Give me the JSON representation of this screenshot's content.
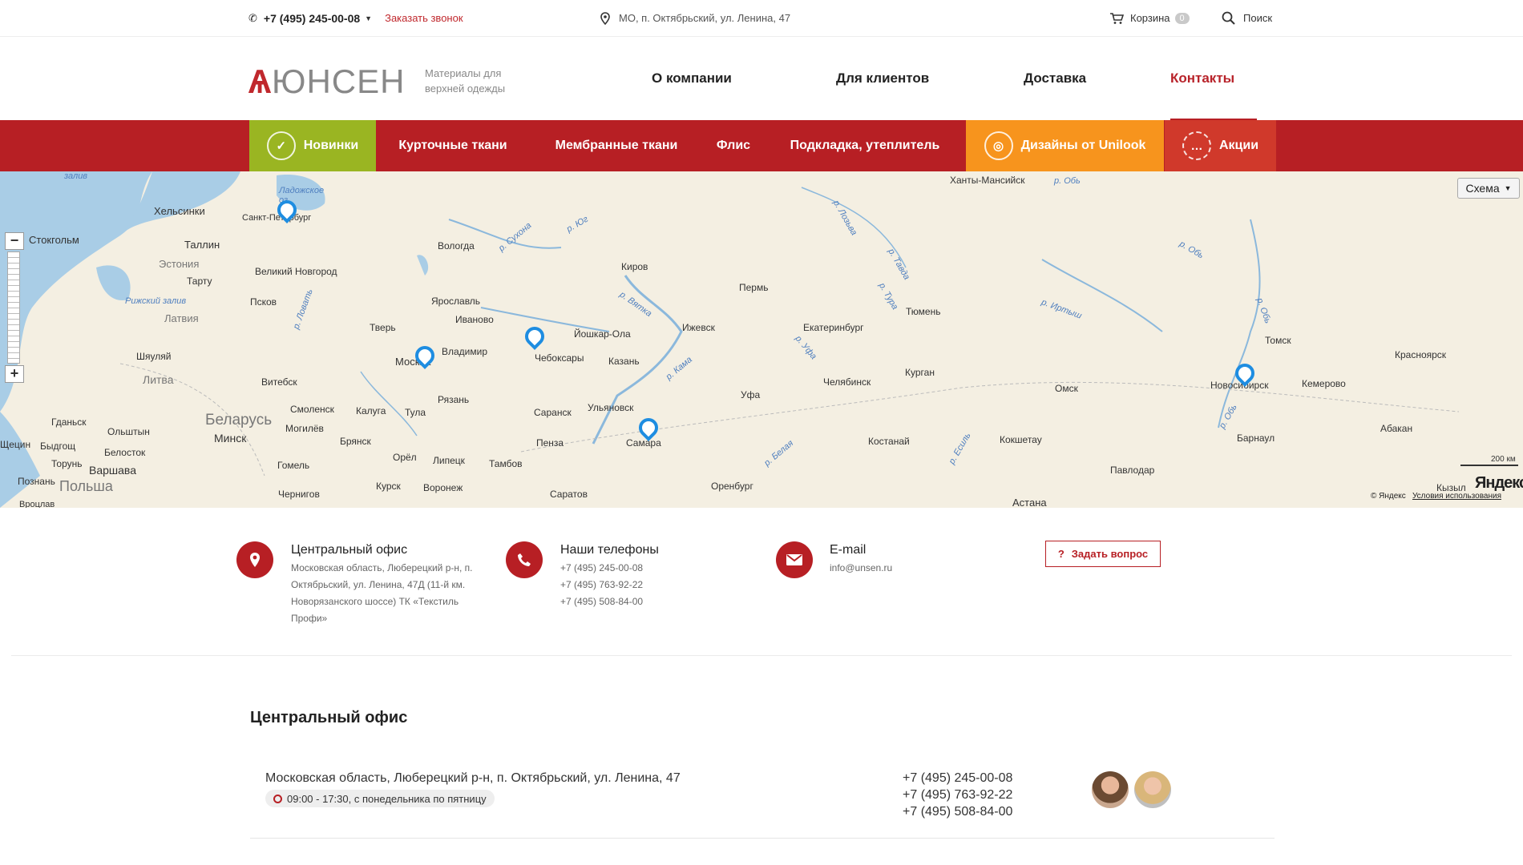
{
  "topbar": {
    "phone": "+7 (495) 245-00-08",
    "callback": "Заказать звонок",
    "address": "МО, п. Октябрьский, ул. Ленина, 47",
    "cart_label": "Корзина",
    "cart_count": "0",
    "search_label": "Поиск"
  },
  "header": {
    "logo_text": "ЮНСЕН",
    "tagline": "Материалы для верхней одежды",
    "nav": [
      "О компании",
      "Для клиентов",
      "Доставка",
      "Контакты"
    ],
    "active_nav": "Контакты"
  },
  "categories": [
    "Новинки",
    "Курточные ткани",
    "Мембранные ткани",
    "Флис",
    "Подкладка, утеплитель",
    "Дизайны от Unilook",
    "Акции"
  ],
  "map": {
    "scheme_label": "Схема",
    "scale_label": "200 км",
    "yandex_logo": "Яндекс",
    "copyright": "© Яндекс",
    "terms": "Условия использования",
    "cities": [
      "Ханты-Мансийск",
      "р. Обь",
      "залив",
      "Хельсинки",
      "Ладожское оз.",
      "Санкт-Петербург",
      "Стокгольм",
      "Таллин",
      "Эстония",
      "Тарту",
      "Вологда",
      "р. Сухона",
      "р. Юг",
      "р. Лозьва",
      "р. Тавда",
      "р. Обь",
      "Великий Новгород",
      "Псков",
      "Рижский залив",
      "Латвия",
      "р. Ловать",
      "Киров",
      "Пермь",
      "р. Тура",
      "Тюмень",
      "р. Иртыш",
      "р. Обь",
      "р. Вятка",
      "Ярославль",
      "Иваново",
      "Тверь",
      "Йошкар-Ола",
      "Ижевск",
      "Екатеринбург",
      "Томск",
      "Шяуляй",
      "Москва",
      "Владимир",
      "Чебоксары",
      "Казань",
      "р. Уфа",
      "Курган",
      "Красноярск",
      "Литва",
      "Витебск",
      "р. Кама",
      "Новосибирск",
      "Кемерово",
      "Челябинск",
      "Уфа",
      "Омск",
      "Смоленск",
      "Калуга",
      "Рязань",
      "Ульяновск",
      "Гданьск",
      "Ольштын",
      "Беларусь",
      "Тула",
      "Саранск",
      "р. Обь",
      "Абакан",
      "Могилёв",
      "Минск",
      "Брянск",
      "Пенза",
      "Костанай",
      "Кокшетау",
      "Барнаул",
      "Щецин",
      "Быдгощ",
      "Самара",
      "Белосток",
      "Орёл",
      "Липецк",
      "р. Белая",
      "р. Есиль",
      "Торунь",
      "Гомель",
      "Тамбов",
      "Павлодар",
      "Варшава",
      "Оренбург",
      "Познань",
      "Польша",
      "Курск",
      "Воронеж",
      "Чернигов",
      "Саратов",
      "Астана",
      "Кызыл",
      "Вроцлав"
    ]
  },
  "contacts": {
    "office_title": "Центральный офис",
    "office_text": "Московская область, Люберецкий р-н, п. Октябрьский, ул. Ленина, 47Д (11-й км. Новорязанского шоссе) ТК «Текстиль Профи»",
    "phones_title": "Наши телефоны",
    "phones": [
      "+7 (495) 245-00-08",
      "+7 (495) 763-92-22",
      "+7 (495) 508-84-00"
    ],
    "email_title": "E-mail",
    "email": "info@unsen.ru",
    "ask_button": "Задать вопрос"
  },
  "office": {
    "heading": "Центральный офис",
    "address": "Московская область, Люберецкий р-н, п. Октябрьский, ул. Ленина, 47",
    "hours": "09:00 - 17:30, с понедельника по пятницу",
    "phones": [
      "+7 (495) 245-00-08",
      "+7 (495) 763-92-22",
      "+7 (495) 508-84-00"
    ]
  },
  "colors": {
    "brand_red": "#b71f24",
    "green_tab": "#9ab522",
    "orange_tab": "#f7941d",
    "accent_red_tab": "#d0392b"
  }
}
